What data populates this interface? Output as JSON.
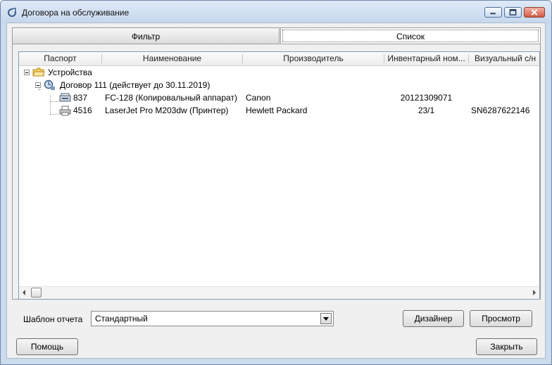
{
  "window": {
    "title": "Договора на обслуживание"
  },
  "tabs": [
    {
      "label": "Фильтр"
    },
    {
      "label": "Список"
    }
  ],
  "columns": [
    "Паспорт",
    "Наименование",
    "Производитель",
    "Инвентарный ном...",
    "Визуальный с/н"
  ],
  "tree": {
    "root": {
      "label": "Устройства"
    },
    "contract": {
      "label": "Договор 111 (действует до 30.11.2019)"
    },
    "items": [
      {
        "passport": "837",
        "name": "FC-128 (Копировальный аппарат)",
        "maker": "Canon",
        "inventory": "20121309071",
        "serial": ""
      },
      {
        "passport": "4516",
        "name": "LaserJet Pro M203dw (Принтер)",
        "maker": "Hewlett Packard",
        "inventory": "23/1",
        "serial": "SN6287622146"
      }
    ]
  },
  "report": {
    "label": "Шаблон отчета",
    "value": "Стандартный"
  },
  "buttons": {
    "designer": "Дизайнер",
    "preview": "Просмотр",
    "help": "Помощь",
    "close": "Закрыть"
  },
  "icons": [
    "refresh-icon",
    "minimize-icon",
    "maximize-icon",
    "close-icon",
    "folder-icon",
    "contract-icon",
    "copier-icon",
    "printer-icon",
    "dropdown-arrow-icon",
    "scroll-left-icon",
    "scroll-right-icon"
  ]
}
